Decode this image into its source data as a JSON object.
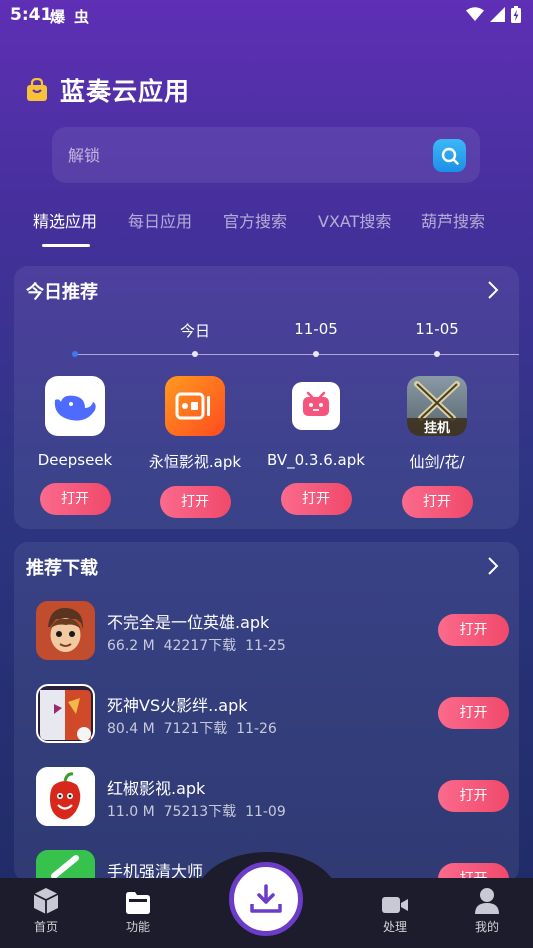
{
  "status_bar": {
    "time": "5:41",
    "app_glyphs": [
      "爆",
      "虫"
    ]
  },
  "header": {
    "title": "蓝奏云应用"
  },
  "search": {
    "placeholder": "解锁"
  },
  "tabs": [
    "精选应用",
    "每日应用",
    "官方搜索",
    "VXAT搜索",
    "葫芦搜索"
  ],
  "today": {
    "title": "今日推荐",
    "dates": [
      "今日",
      "11-05",
      "11-05"
    ],
    "apps": [
      {
        "name": "Deepseek",
        "button": "打开"
      },
      {
        "name": "永恒影视.apk",
        "button": "打开"
      },
      {
        "name": "BV_0.3.6.apk",
        "button": "打开"
      },
      {
        "name": "仙剑/花/",
        "button": "打开"
      }
    ],
    "icon_badge": "挂机"
  },
  "downloads": {
    "title": "推荐下载",
    "items": [
      {
        "name": "不完全是一位英雄.apk",
        "size": "66.2 M",
        "downloads": "42217下载",
        "date": "11-25",
        "button": "打开"
      },
      {
        "name": "死神VS火影绊..apk",
        "size": "80.4 M",
        "downloads": "7121下载",
        "date": "11-26",
        "button": "打开"
      },
      {
        "name": "红椒影视.apk",
        "size": "11.0 M",
        "downloads": "75213下载",
        "date": "11-09",
        "button": "打开"
      },
      {
        "name": "手机强清大师",
        "size": "",
        "downloads": "",
        "date": "",
        "button": "打开"
      }
    ]
  },
  "nav": {
    "home": "首页",
    "features": "功能",
    "process": "处理",
    "mine": "我的"
  },
  "colors": {
    "accent_pink": "#f0496b",
    "search_blue": "#1d8fe8",
    "timeline_current": "#3a7cf0"
  },
  "icons": {
    "header": "shopping-bag-icon",
    "search": "search-icon",
    "more": "chevron-right-icon",
    "nav": [
      "cube-icon",
      "folder-icon",
      "download-icon",
      "video-camera-icon",
      "person-icon"
    ]
  }
}
